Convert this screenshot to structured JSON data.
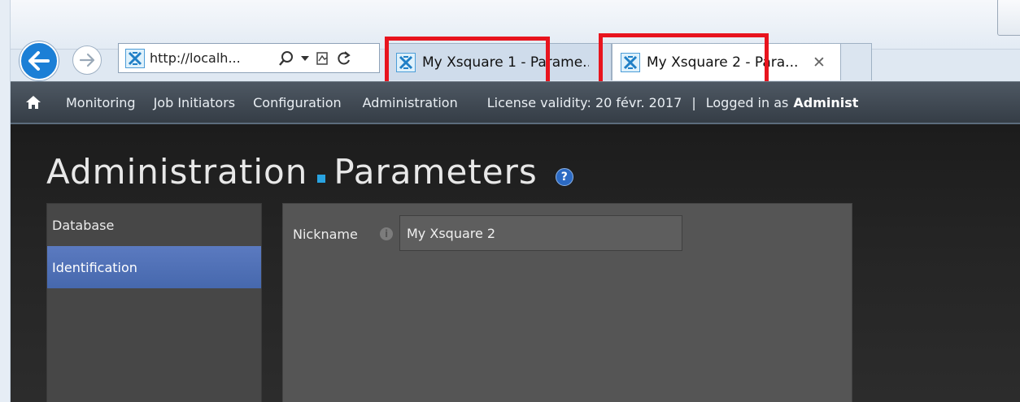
{
  "browser": {
    "address_text": "http://localh...",
    "tabs": [
      {
        "label": "My Xsquare 1 - Parame..."
      },
      {
        "label": "My Xsquare 2 - Para..."
      }
    ],
    "close_glyph": "✕",
    "icons": [
      "back-arrow-icon",
      "forward-arrow-icon",
      "xsquare-favicon",
      "search-icon",
      "dropdown-arrow-icon",
      "compatibility-view-icon",
      "refresh-icon",
      "close-icon"
    ],
    "highlight_color": "#e8141e"
  },
  "app_nav": {
    "items": [
      "Monitoring",
      "Job Initiators",
      "Configuration",
      "Administration"
    ],
    "license": "License validity: 20 févr. 2017",
    "separator": "|",
    "logged_in_prefix": "Logged in as",
    "user": "Administ"
  },
  "page": {
    "title_section": "Administration",
    "title_page": "Parameters",
    "help_glyph": "?",
    "accent_color": "#29a3e1"
  },
  "side_menu": {
    "items": [
      "Database",
      "Identification"
    ],
    "selected": "Identification"
  },
  "form": {
    "nickname_label": "Nickname",
    "info_glyph": "i",
    "nickname_value": "My Xsquare 2"
  }
}
